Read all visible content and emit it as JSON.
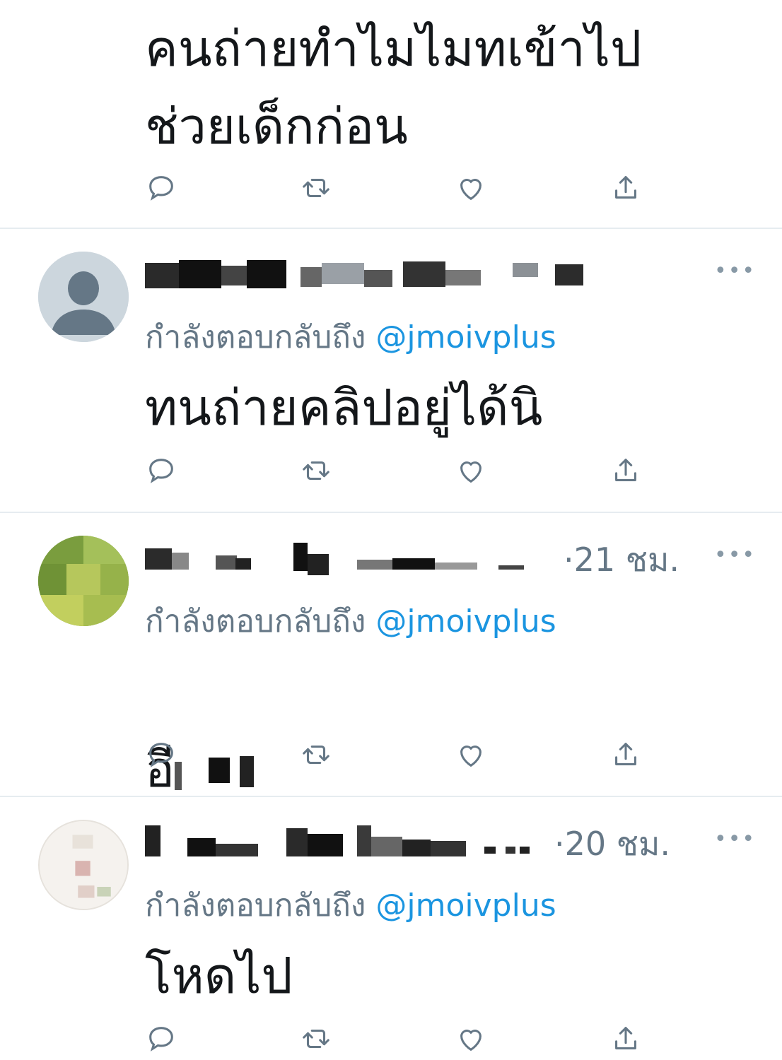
{
  "tweets": [
    {
      "body": "คนถ่ายทำไมไมทเข้าไป\nช่วยเด็กก่อน"
    },
    {
      "reply_prefix": "กำลังตอบกลับถึง",
      "reply_handle": "@jmoivplus",
      "time": "",
      "body": "ทนถ่ายคลิปอยู่ได้นิ",
      "more": "•••"
    },
    {
      "reply_prefix": "กำลังตอบกลับถึง",
      "reply_handle": "@jmoivplus",
      "time": "·21 ชม.",
      "body": "อี",
      "more": "•••"
    },
    {
      "reply_prefix": "กำลังตอบกลับถึง",
      "reply_handle": "@jmoivplus",
      "time": "·20 ชม.",
      "body": "โหดไป",
      "more": "•••"
    }
  ],
  "icons": [
    "reply-icon",
    "retweet-icon",
    "like-icon",
    "share-icon"
  ],
  "colors": {
    "text": "#14171a",
    "muted": "#657786",
    "link": "#1b95e0",
    "divider": "#e6ecf0"
  }
}
